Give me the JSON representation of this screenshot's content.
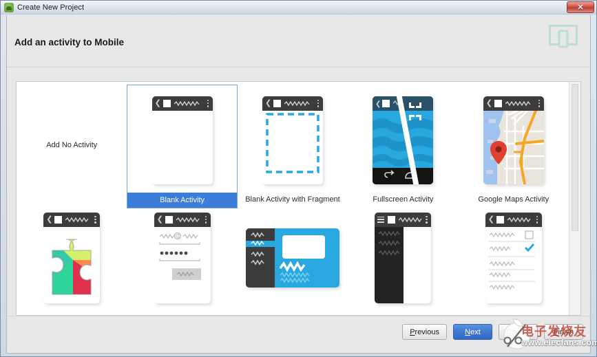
{
  "window": {
    "title": "Create New Project",
    "app_icon": "android-robot-icon",
    "close_label": "✕"
  },
  "header": {
    "title": "Add an activity to Mobile",
    "form_factor_icon": "mobile-device-outline-icon"
  },
  "gallery": {
    "rows": [
      {
        "items": [
          {
            "label": "Add No Activity",
            "kind": "text-only",
            "selected": false
          },
          {
            "label": "Blank Activity",
            "kind": "blank",
            "selected": true
          },
          {
            "label": "Blank Activity with Fragment",
            "kind": "fragment",
            "selected": false
          },
          {
            "label": "Fullscreen Activity",
            "kind": "fullscreen",
            "selected": false
          },
          {
            "label": "Google Maps Activity",
            "kind": "maps",
            "selected": false
          }
        ]
      },
      {
        "items": [
          {
            "label": "",
            "kind": "google-play-services",
            "selected": false
          },
          {
            "label": "",
            "kind": "login",
            "selected": false
          },
          {
            "label": "",
            "kind": "master-detail",
            "selected": false
          },
          {
            "label": "",
            "kind": "navigation-drawer",
            "selected": false
          },
          {
            "label": "",
            "kind": "settings",
            "selected": false
          }
        ]
      }
    ],
    "scroll": {
      "thumb_percent": 63
    }
  },
  "footer": {
    "previous": {
      "pre": "",
      "mnemonic": "P",
      "post": "revious"
    },
    "next": {
      "pre": "",
      "mnemonic": "N",
      "post": "ext"
    },
    "cancel": {
      "pre": "",
      "mnemonic": "C",
      "post": "ancel"
    },
    "finish": {
      "pre": "",
      "mnemonic": "F",
      "post": "inish"
    }
  },
  "watermark": {
    "text": "电子发烧友",
    "url": "www.elecfans.com"
  },
  "colors": {
    "accent_blue": "#3b7dd8",
    "material_blue": "#29a8df",
    "toolbar_dark": "#3c3c3c",
    "map_water": "#9fc2ef",
    "map_land": "#e9e5dc",
    "map_road": "#f5a623",
    "map_pin": "#e0402f",
    "dialog_bg": "#e8e8e8"
  }
}
